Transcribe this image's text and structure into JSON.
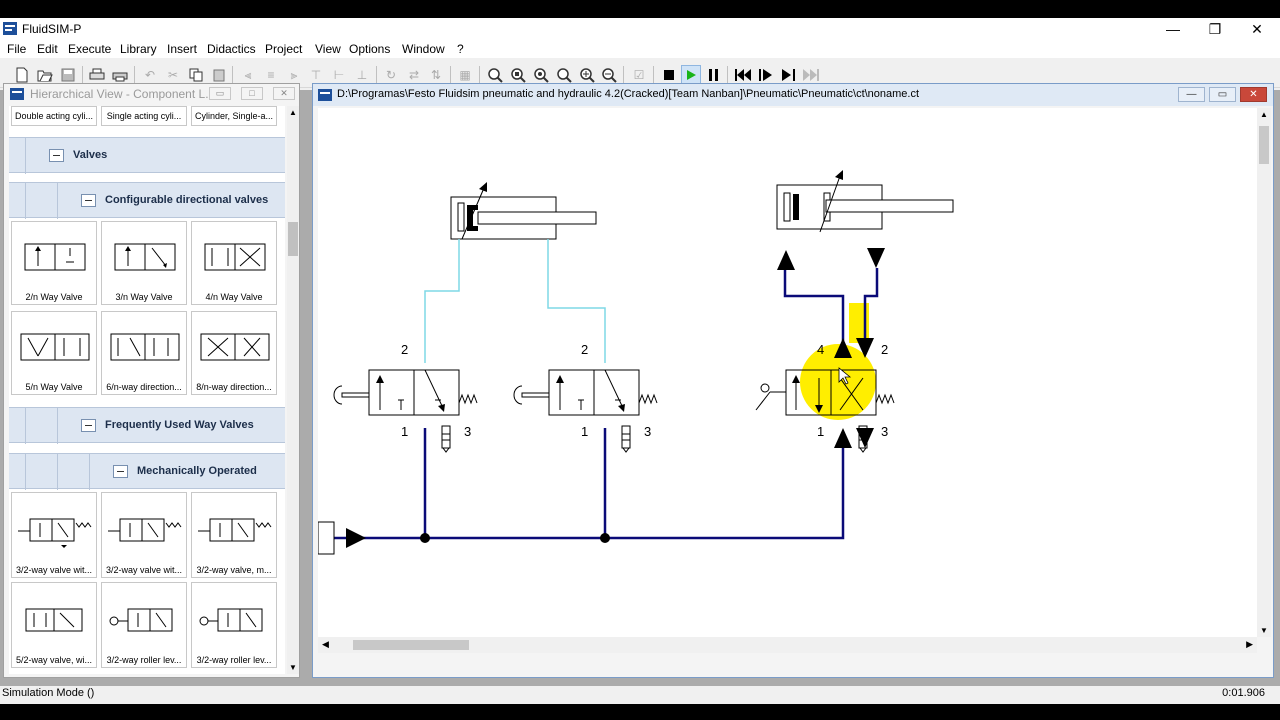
{
  "app": {
    "title": "FluidSIM-P",
    "window_controls": {
      "minimize": "—",
      "restore": "❐",
      "close": "✕"
    }
  },
  "menu": [
    "File",
    "Edit",
    "Execute",
    "Library",
    "Insert",
    "Didactics",
    "Project",
    "View",
    "Options",
    "Window",
    "?"
  ],
  "toolbar": {
    "icons": [
      "new-icon",
      "open-icon",
      "save-icon",
      "print-preview-icon",
      "print-icon",
      "undo-icon",
      "cut-icon",
      "copy-icon",
      "paste-icon",
      "align-left-icon",
      "align-center-icon",
      "align-right-icon",
      "align-top-icon",
      "align-middle-icon",
      "align-bottom-icon",
      "rotate-icon",
      "flip-h-icon",
      "flip-v-icon",
      "grid-icon",
      "zoom-1-icon",
      "zoom-window-icon",
      "zoom-fit-icon",
      "zoom-prev-icon",
      "zoom-in-icon",
      "zoom-out-icon",
      "check-icon",
      "stop-icon",
      "play-icon",
      "pause-icon",
      "rewind-icon",
      "step-icon",
      "step-end-icon",
      "fast-forward-icon"
    ]
  },
  "library_panel": {
    "title": "Hierarchical View - Component L...",
    "top_items": [
      "Double acting cyli...",
      "Single acting cyli...",
      "Cylinder, Single-a..."
    ],
    "groups": {
      "valves": "Valves",
      "configurable": "Configurable directional valves",
      "frequent": "Frequently Used Way Valves",
      "mechanical": "Mechanically Operated"
    },
    "configurable_items": [
      "2/n Way Valve",
      "3/n Way Valve",
      "4/n Way Valve",
      "5/n Way Valve",
      "6/n-way direction...",
      "8/n-way direction..."
    ],
    "mechanical_items": [
      "3/2-way valve wit...",
      "3/2-way valve wit...",
      "3/2-way valve, m...",
      "5/2-way valve, wi...",
      "3/2-way roller lev...",
      "3/2-way roller lev..."
    ]
  },
  "document": {
    "title": "D:\\Programas\\Festo Fluidsim pneumatic and hydraulic 4.2(Cracked)[Team Nanban]\\Pneumatic\\Pneumatic\\ct\\noname.ct",
    "port_labels": {
      "v1": [
        "2",
        "1",
        "3"
      ],
      "v2": [
        "2",
        "1",
        "3"
      ],
      "v3": [
        "4",
        "2",
        "1",
        "3"
      ]
    },
    "colors": {
      "pressurized": "#0a0a78",
      "exhausted": "#7fd8e6",
      "highlight": "#ffee00"
    }
  },
  "status": {
    "mode": "Simulation Mode ()",
    "time": "0:01.906"
  }
}
